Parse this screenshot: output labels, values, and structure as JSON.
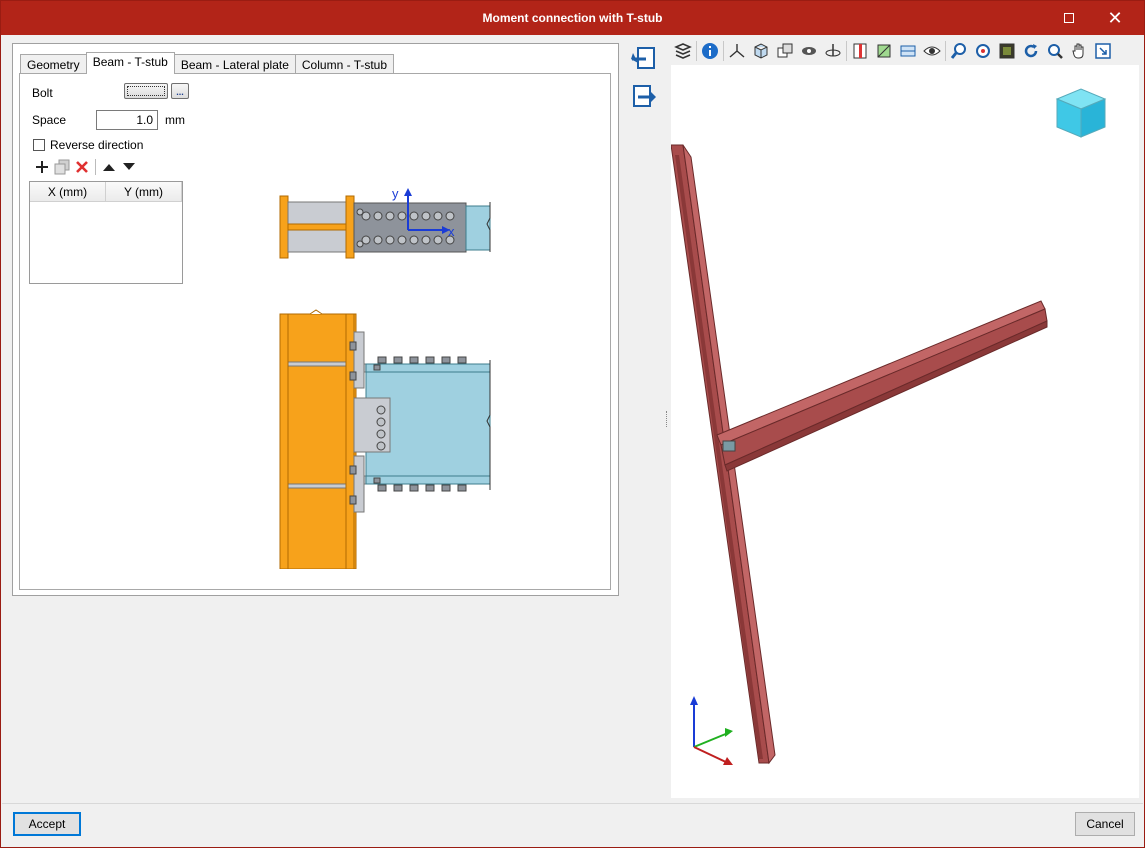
{
  "window": {
    "title": "Moment connection with T-stub"
  },
  "tabs": [
    {
      "label": "Geometry"
    },
    {
      "label": "Beam - T-stub"
    },
    {
      "label": "Beam - Lateral plate"
    },
    {
      "label": "Column - T-stub"
    }
  ],
  "form": {
    "bolt_label": "Bolt",
    "dots_label": "...",
    "space_label": "Space",
    "space_value": "1.0",
    "space_unit": "mm",
    "reverse_label": "Reverse direction",
    "reverse_checked": false
  },
  "table": {
    "columns": [
      "X (mm)",
      "Y (mm)"
    ],
    "rows": []
  },
  "drawing": {
    "axis_y": "y",
    "axis_x": "x"
  },
  "buttons": {
    "accept": "Accept",
    "cancel": "Cancel"
  },
  "colors": {
    "titlebar": "#b22418",
    "column": "#f7a21b",
    "beam": "#9fd0e0",
    "plate": "#b9bec6",
    "model3d": "#a84c4c",
    "axis_blue": "#1a3cd6"
  }
}
